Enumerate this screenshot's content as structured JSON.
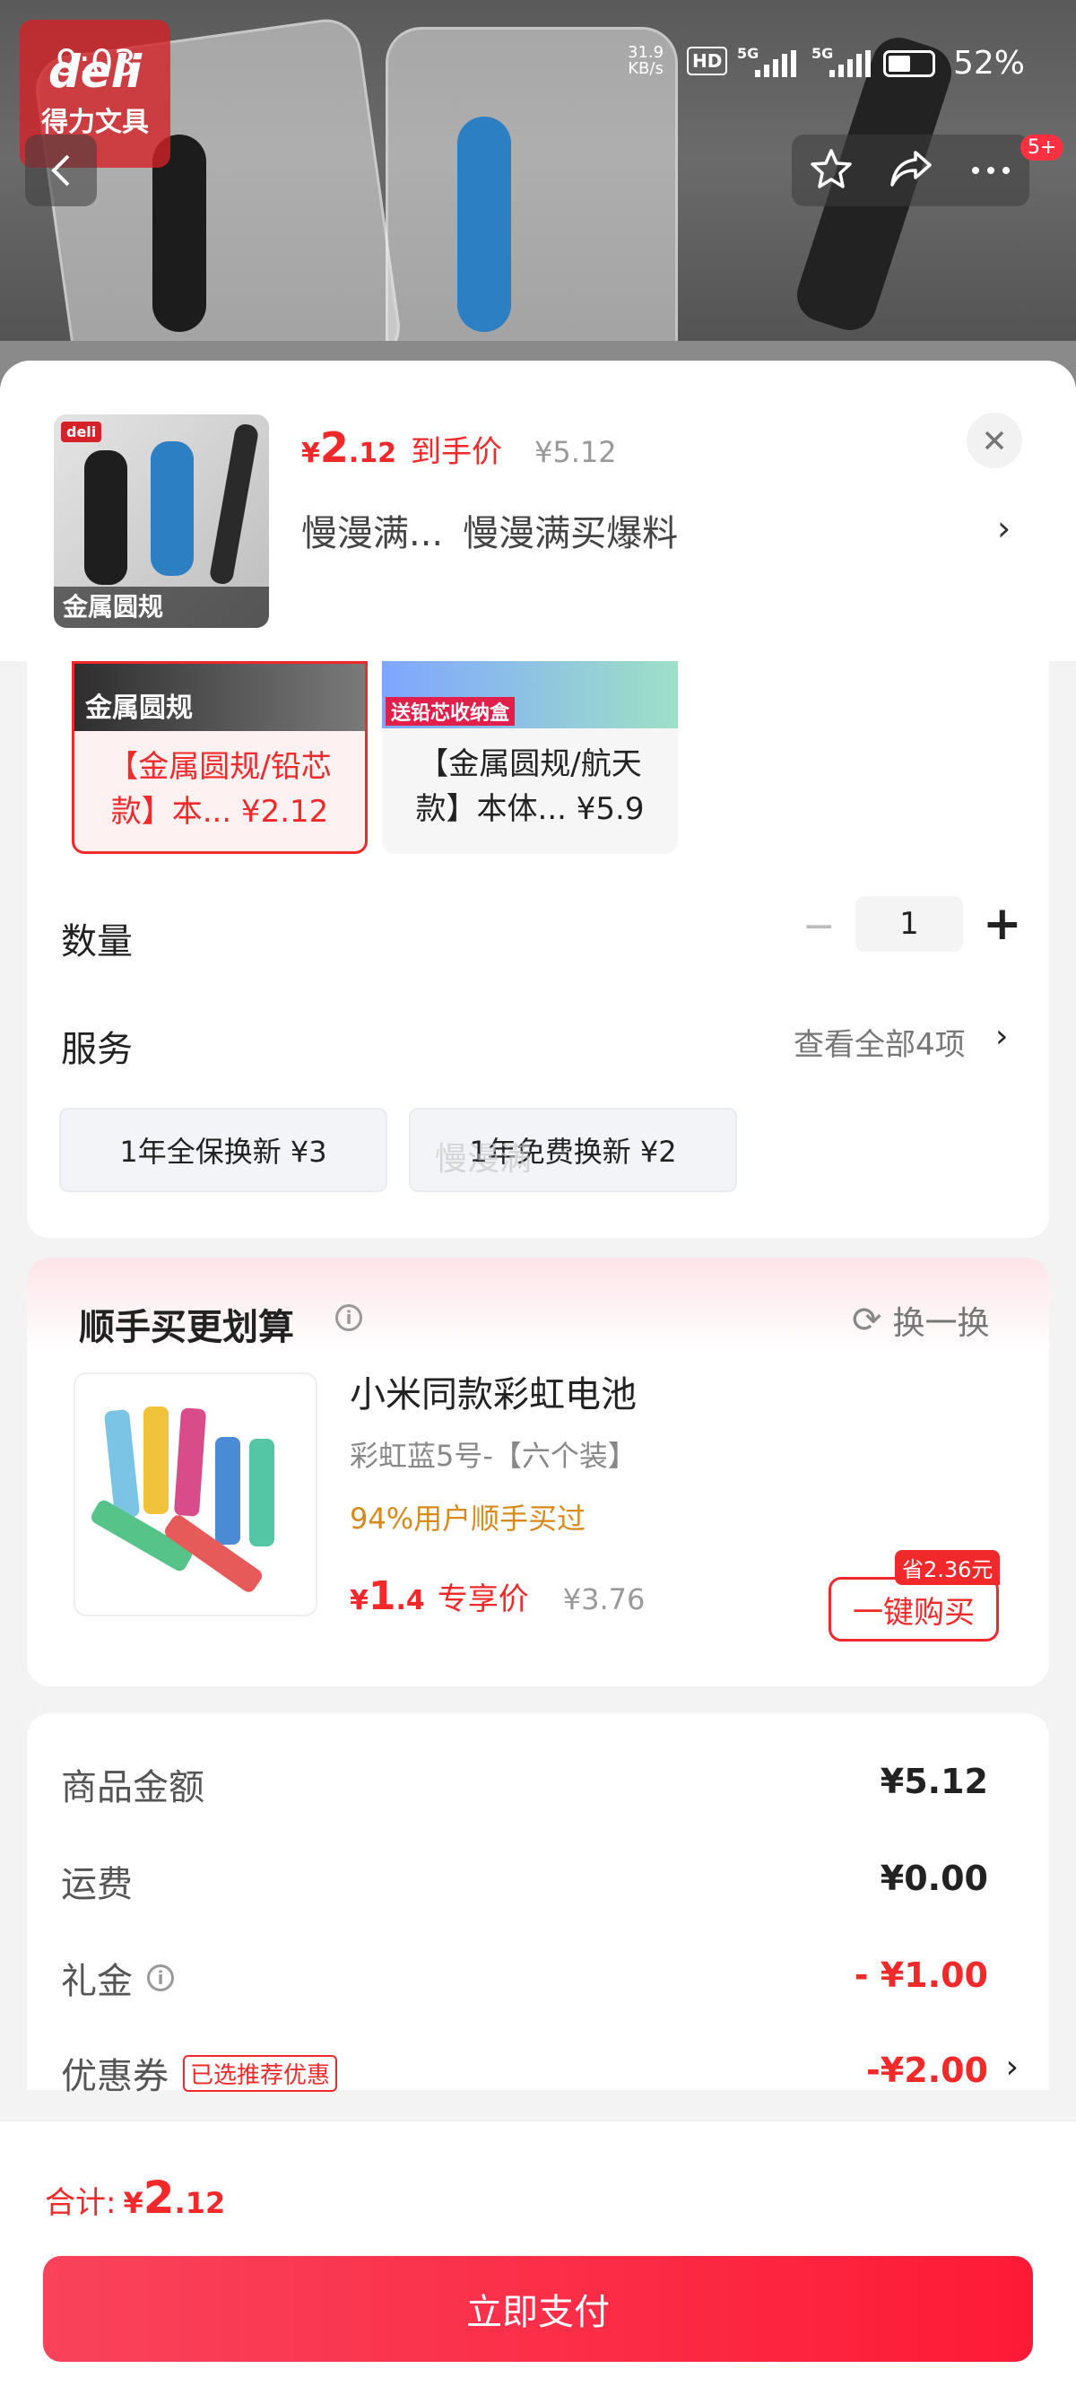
{
  "status_bar": {
    "time": "9:03",
    "net_speed": "31.9",
    "net_unit": "KB/s",
    "hd": "HD",
    "sig1": "5G",
    "sig2": "5G",
    "battery_percent": "52%",
    "battery_level": 0.52
  },
  "brand": {
    "logo_text": "deli",
    "logo_sub": "得力文具"
  },
  "nav": {
    "badge": "5+",
    "icons": [
      "back-icon",
      "star-icon",
      "share-icon",
      "more-icon"
    ]
  },
  "product": {
    "thumb_label": "金属圆规",
    "thumb_logo": "deli",
    "price_symbol": "¥",
    "price_int": "2",
    "price_dec": ".12",
    "price_tag": "到手价",
    "orig_price": "¥5.12",
    "spec_short": "慢漫满...",
    "spec_full": "慢漫满买爆料"
  },
  "variants": [
    {
      "img_label": "金属圆规",
      "text_line1": "【金属圆规/铅芯",
      "text_line2": "款】本... ¥2.12",
      "selected": true
    },
    {
      "img_label": "送铅芯收纳盒",
      "text_line1": "【金属圆规/航天",
      "text_line2": "款】本体... ¥5.9",
      "selected": false
    }
  ],
  "quantity": {
    "label": "数量",
    "minus": "−",
    "value": "1",
    "plus": "+"
  },
  "service": {
    "label": "服务",
    "view_all": "查看全部4项",
    "options": [
      "1年全保换新  ¥3",
      "1年免费换新  ¥2"
    ],
    "watermark": "慢漫满"
  },
  "combo": {
    "title": "顺手买更划算",
    "refresh": "换一换",
    "name": "小米同款彩虹电池",
    "spec": "彩虹蓝5号-【六个装】",
    "hot": "94%用户顺手买过",
    "price_symbol": "¥",
    "price_int": "1",
    "price_dec": ".4",
    "price_tag": "专享价",
    "orig_price": "¥3.76",
    "save_badge": "省2.36元",
    "buy_label": "一键购买"
  },
  "summary": {
    "goods_label": "商品金额",
    "goods_value": "¥5.12",
    "shipping_label": "运费",
    "shipping_value": "¥0.00",
    "gift_label": "礼金",
    "gift_value": "- ¥1.00",
    "coupon_label": "优惠券",
    "coupon_tag": "已选推荐优惠",
    "coupon_value": "-¥2.00"
  },
  "footer": {
    "total_label": "合计:",
    "total_symbol": "¥",
    "total_int": "2",
    "total_dec": ".12",
    "pay_label": "立即支付"
  },
  "colors": {
    "accent": "#f2292a",
    "pay_start": "#f9435b",
    "pay_end": "#fe1a36",
    "hot": "#d7891b"
  }
}
